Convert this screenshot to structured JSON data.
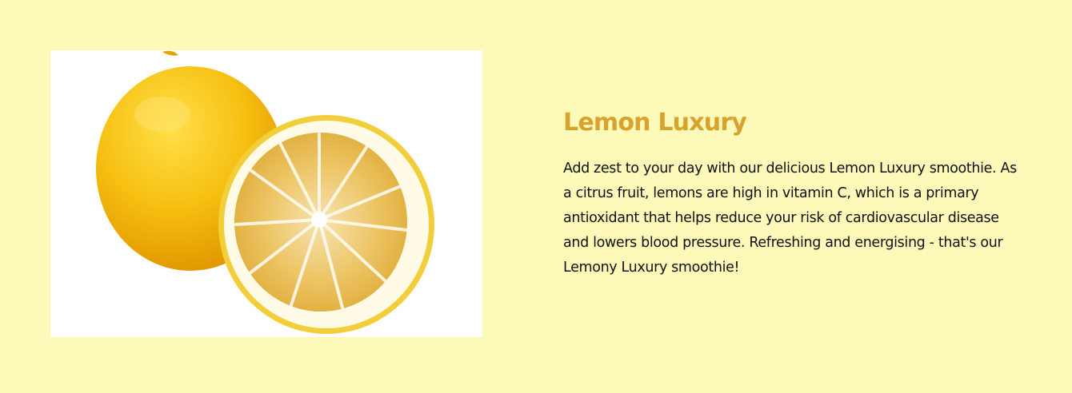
{
  "product": {
    "image_alt": "lemon-image",
    "title": "Lemon Luxury",
    "description": "Add zest to your day with our delicious Lemon Luxury smoothie. As a citrus fruit, lemons are high in vitamin C, which is a primary antioxidant that helps reduce your risk of cardiovascular disease and lowers blood pressure. Refreshing and energising - that's our Lemony Luxury smoothie!"
  },
  "colors": {
    "background": "#fdf9b8",
    "title": "#d9a22c",
    "text": "#111111",
    "lemon_peel": "#f5b90a",
    "lemon_flesh": "#e8b94a"
  }
}
